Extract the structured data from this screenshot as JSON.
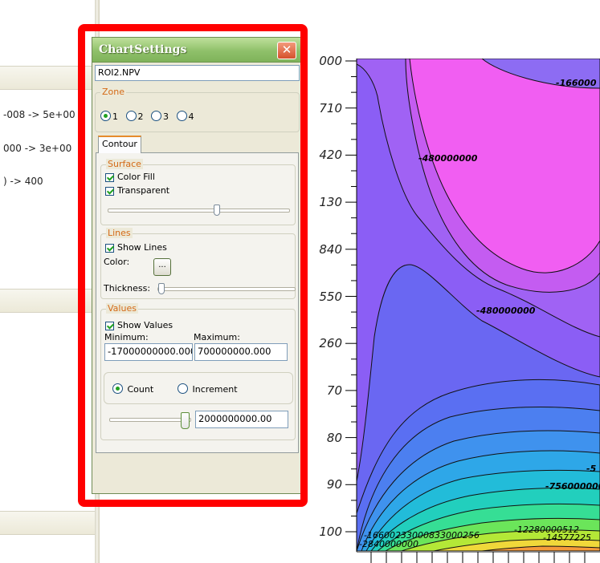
{
  "background": {
    "legend_lines": [
      "-008 -> 5e+00",
      "000 -> 3e+00",
      ") -> 400"
    ]
  },
  "dialog": {
    "title": "ChartSettings",
    "close_icon": "close-icon",
    "roi_name": "ROI2.NPV",
    "zone": {
      "legend": "Zone",
      "options": [
        "1",
        "2",
        "3",
        "4"
      ],
      "selected": "1"
    },
    "tab": "Contour",
    "surface": {
      "legend": "Surface",
      "color_fill": "Color Fill",
      "transparent": "Transparent"
    },
    "lines": {
      "legend": "Lines",
      "show_lines": "Show Lines",
      "color_label": "Color:",
      "color_button": "...",
      "thickness_label": "Thickness:"
    },
    "values": {
      "legend": "Values",
      "show_values": "Show Values",
      "minimum_label": "Minimum:",
      "maximum_label": "Maximum:",
      "minimum": "-17000000000.000",
      "maximum": "700000000.000",
      "count_label": "Count",
      "increment_label": "Increment",
      "mode_selected": "Count",
      "step_value": "2000000000.00"
    }
  },
  "chart": {
    "y_ticks": [
      "000",
      "710",
      "420",
      "130",
      "840",
      "550",
      "260",
      "70",
      "80",
      "90",
      "100"
    ],
    "contour_labels": [
      "-480000000",
      "-480000000",
      "-166000",
      "-5",
      "-756000000",
      "-12280000512",
      "-16600233000833000256",
      "-2840000000",
      "-14577225"
    ]
  }
}
